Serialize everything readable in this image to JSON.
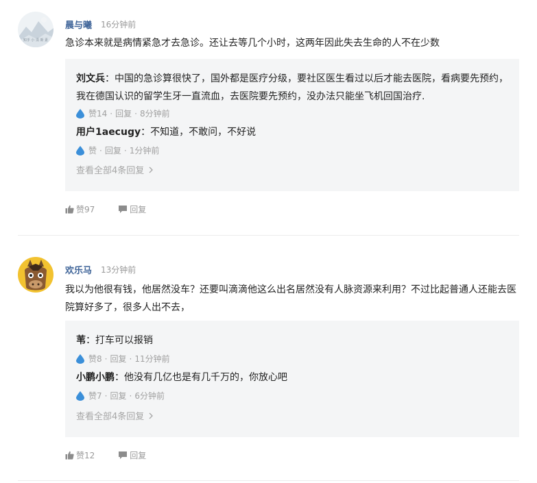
{
  "comments": [
    {
      "username": "晨与曦",
      "time": "16分钟前",
      "avatar_caption": "知乎 小 清 新 素",
      "text": "急诊本来就是病情紧急才去急诊。还让去等几个小时，这两年因此失去生命的人不在少数",
      "replies": [
        {
          "name": "刘文兵",
          "text": "中国的急诊算很快了，国外都是医疗分级，要社区医生看过以后才能去医院，看病要先预约，我在德国认识的留学生牙一直流血，去医院要先预约，没办法只能坐飞机回国治疗.",
          "likes": "赞14",
          "reply_label": "回复",
          "time": "8分钟前"
        },
        {
          "name": "用户1aecugy",
          "text": "不知道，不敢问，不好说",
          "likes": "赞",
          "reply_label": "回复",
          "time": "1分钟前"
        }
      ],
      "view_all": "查看全部4条回复",
      "likes": "赞97",
      "reply_label": "回复"
    },
    {
      "username": "欢乐马",
      "time": "13分钟前",
      "text": "我以为他很有钱，他居然没车？还要叫滴滴他这么出名居然没有人脉资源来利用？不过比起普通人还能去医院算好多了，很多人出不去，",
      "replies": [
        {
          "name": "苇",
          "text": "打车可以报销",
          "likes": "赞8",
          "reply_label": "回复",
          "time": "11分钟前"
        },
        {
          "name": "小鹏小鹏",
          "text": "他没有几亿也是有几千万的，你放心吧",
          "likes": "赞7",
          "reply_label": "回复",
          "time": "6分钟前"
        }
      ],
      "view_all": "查看全部4条回复",
      "likes": "赞12",
      "reply_label": "回复"
    }
  ],
  "colors": {
    "username": "#406599",
    "reply_bg": "#f4f5f6",
    "meta": "#a0a0a0",
    "drop_icon": "#3b8fd9"
  },
  "icons": [
    "water-drop-icon",
    "thumbs-up-icon",
    "speech-bubble-icon",
    "chevron-right-icon"
  ]
}
